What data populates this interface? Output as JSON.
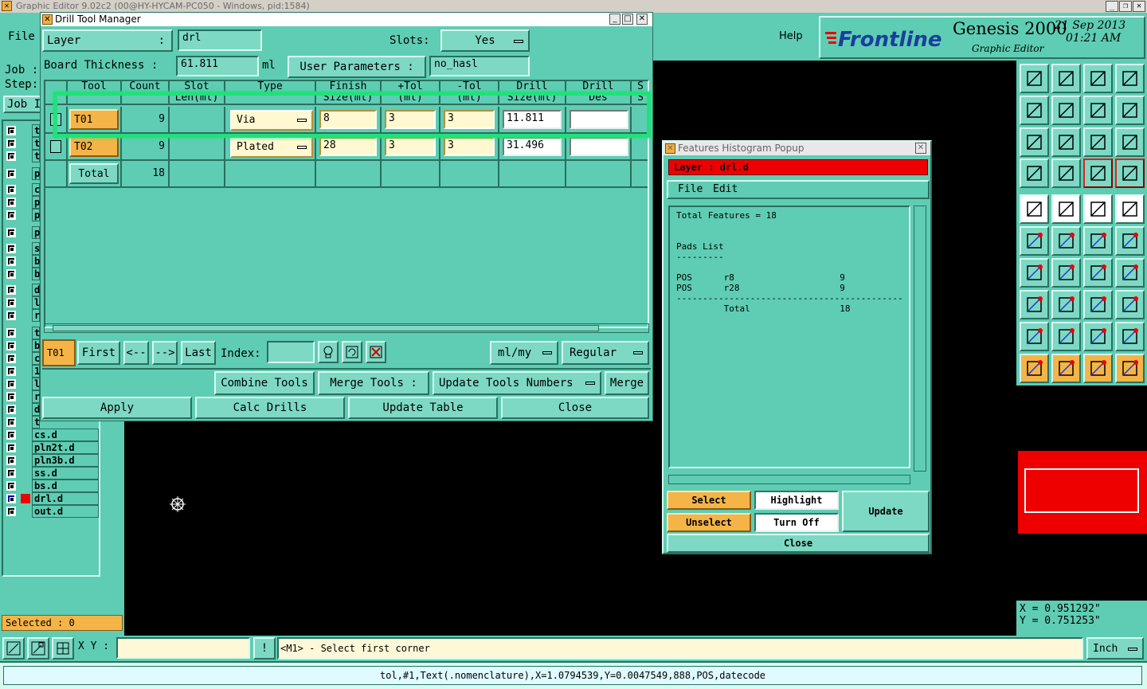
{
  "window": {
    "title": "Graphic Editor 9.02c2 (00@HY-HYCAM-PC050 - Windows, pid:1584)"
  },
  "top": {
    "file_menu": "File",
    "help": "Help",
    "brand": "Frontline",
    "product": "Genesis 2000",
    "subtitle": "Graphic Editor",
    "date": "21 Sep 2013",
    "time": "01:21 AM"
  },
  "left_panel": {
    "job_label": "Job :",
    "step_label": "Step:",
    "job_btn": "Job I",
    "selected": "Selected : 0",
    "layers_top": [
      "t",
      "t",
      "t",
      "p",
      "c",
      "p",
      "p",
      "p",
      "s",
      "b",
      "b",
      "d",
      "l",
      "r",
      "t",
      "b",
      "c",
      "1",
      "l",
      "r",
      "d",
      "t"
    ],
    "layers": [
      "cs.d",
      "pln2t.d",
      "pln3b.d",
      "ss.d",
      "bs.d",
      "drl.d",
      "out.d"
    ]
  },
  "dtm": {
    "title": "Drill Tool Manager",
    "layer_label": "Layer",
    "layer_colon": ":",
    "layer_value": "drl",
    "slots_label": "Slots:",
    "slots_value": "Yes",
    "thickness_label": "Board Thickness :",
    "thickness_value": "61.811",
    "thickness_unit": "ml",
    "user_params_label": "User Parameters :",
    "user_params_value": "no_hasl",
    "headers": [
      {
        "l1": "Tool",
        "l2": ""
      },
      {
        "l1": "Count",
        "l2": ""
      },
      {
        "l1": "Slot",
        "l2": "Len(ml)"
      },
      {
        "l1": "Type",
        "l2": ""
      },
      {
        "l1": "Finish",
        "l2": "Size(ml)"
      },
      {
        "l1": "+Tol",
        "l2": "(ml)"
      },
      {
        "l1": "-Tol",
        "l2": "(ml)"
      },
      {
        "l1": "Drill",
        "l2": "Size(ml)"
      },
      {
        "l1": "Drill",
        "l2": "Des"
      },
      {
        "l1": "S",
        "l2": "S"
      }
    ],
    "rows": [
      {
        "tool": "T01",
        "count": "9",
        "type": "Via",
        "finish": "8",
        "ptol": "3",
        "ntol": "3",
        "drill": "11.811",
        "des": ""
      },
      {
        "tool": "T02",
        "count": "9",
        "type": "Plated",
        "finish": "28",
        "ptol": "3",
        "ntol": "3",
        "drill": "31.496",
        "des": ""
      }
    ],
    "total_label": "Total",
    "total_count": "18",
    "current_tool": "T01",
    "first": "First",
    "prev": "<--",
    "next": "-->",
    "last": "Last",
    "index_label": "Index:",
    "index_value": "",
    "units": "ml/my",
    "mode": "Regular",
    "combine": "Combine Tools",
    "merge_label": "Merge Tools :",
    "merge_select": "Update Tools Numbers",
    "merge_btn": "Merge",
    "apply": "Apply",
    "calc": "Calc Drills",
    "update_table": "Update Table",
    "close": "Close"
  },
  "hist": {
    "title": "Features Histogram Popup",
    "layer": "Layer :  drl.d",
    "file": "File",
    "edit": "Edit",
    "lines": [
      "Total Features = 18",
      "",
      "",
      "Pads List",
      "---------",
      "",
      "POS      r8                    9",
      "POS      r28                   9",
      "-------------------------------------------",
      "         Total                 18"
    ],
    "select": "Select",
    "highlight": "Highlight",
    "update": "Update",
    "unselect": "Unselect",
    "turn_off": "Turn Off",
    "close": "Close"
  },
  "coords": {
    "x": "X = 0.951292\"",
    "y": "Y = 0.751253\""
  },
  "status": {
    "xy_label": "X Y :",
    "xy_value": "",
    "excl": "!",
    "prompt": "<M1> - Select first corner",
    "units": "Inch",
    "bottom_text": "tol,#1,Text(.nomenclature),X=1.0794539,Y=0.0047549,888,POS,datecode"
  },
  "colors": {
    "teal": "#5ecdb3",
    "highlight": "#22e07a",
    "yellow": "#f4b447",
    "red": "#ee0000"
  }
}
